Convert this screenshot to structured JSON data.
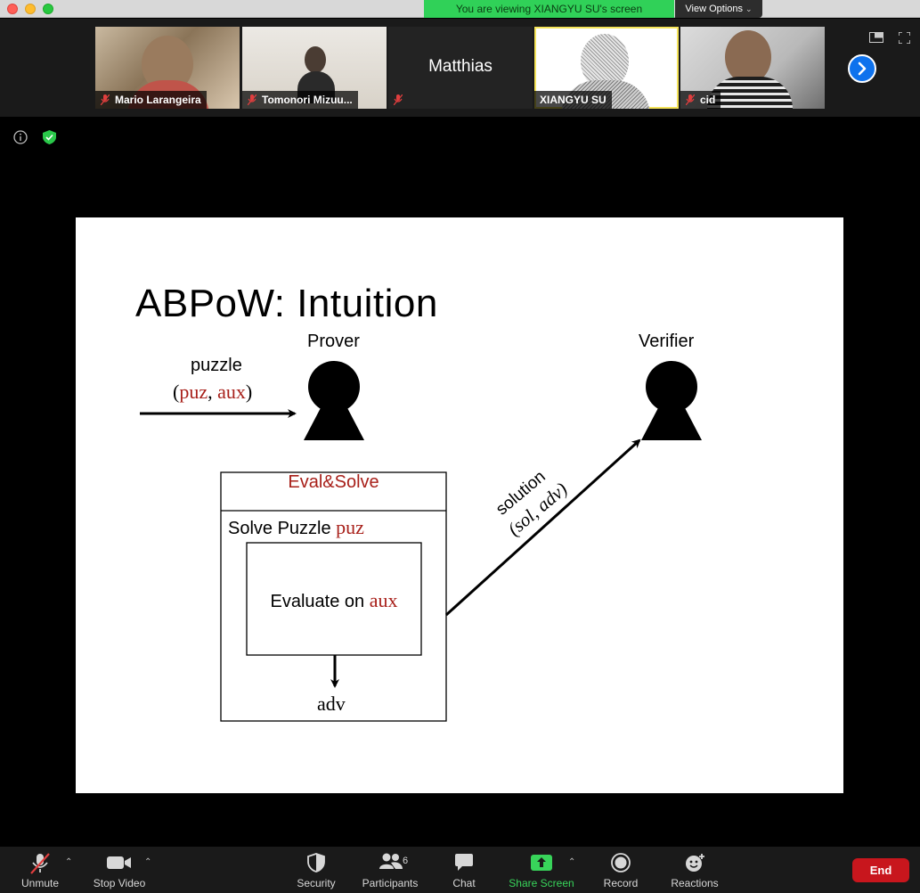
{
  "window": {
    "viewing_banner": "You are viewing XIANGYU SU's screen",
    "view_options": "View Options"
  },
  "participants": [
    {
      "name": "Mario Larangeira",
      "muted": true,
      "video": true
    },
    {
      "name": "Tomonori Mizuu...",
      "muted": true,
      "video": true
    },
    {
      "name": "Matthias",
      "muted": true,
      "video": false
    },
    {
      "name": "XIANGYU SU",
      "muted": false,
      "video": true,
      "active_speaker": true
    },
    {
      "name": "cid",
      "muted": true,
      "video": true
    }
  ],
  "slide": {
    "title": "ABPoW: Intuition",
    "prover": "Prover",
    "verifier": "Verifier",
    "puzzle_label": "puzzle",
    "puzzle_tuple": {
      "open": "(",
      "puz": "puz",
      "sep": ", ",
      "aux": "aux",
      "close": ")"
    },
    "box_title": "Eval&Solve",
    "solve_text": "Solve Puzzle ",
    "solve_var": "puz",
    "evaluate_text": "Evaluate on ",
    "evaluate_var": "aux",
    "adv": "adv",
    "solution_label": "solution",
    "solution_tuple": "(sol, adv)"
  },
  "toolbar": {
    "unmute": "Unmute",
    "stop_video": "Stop Video",
    "security": "Security",
    "participants": "Participants",
    "participant_count": "6",
    "chat": "Chat",
    "share_screen": "Share Screen",
    "record": "Record",
    "reactions": "Reactions",
    "end": "End"
  },
  "colors": {
    "banner_green": "#30d158",
    "share_green": "#38d45a",
    "end_red": "#c8161d",
    "slide_red": "#a8201a",
    "next_blue": "#0e72ed"
  }
}
